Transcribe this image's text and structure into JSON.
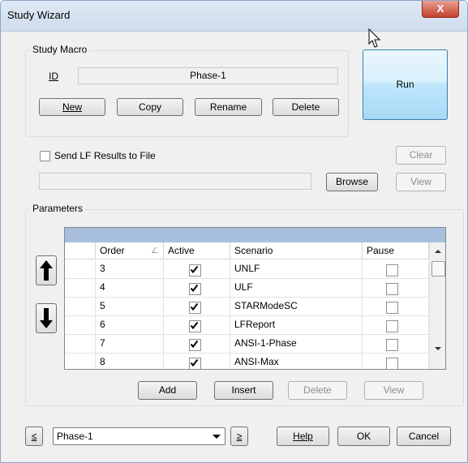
{
  "window": {
    "title": "Study Wizard",
    "close_glyph": "X"
  },
  "study_macro": {
    "label": "Study Macro",
    "id_label": "ID",
    "id_value": "Phase-1",
    "buttons": {
      "new": "New",
      "copy": "Copy",
      "rename": "Rename",
      "delete": "Delete"
    }
  },
  "run_label": "Run",
  "send_results": {
    "label": "Send LF Results to File",
    "checked": false,
    "path_value": ""
  },
  "clear_label": "Clear",
  "browse_label": "Browse",
  "view_label": "View",
  "parameters": {
    "label": "Parameters",
    "columns": {
      "order": "Order",
      "active": "Active",
      "scenario": "Scenario",
      "pause": "Pause"
    },
    "sort_glyph": "∠",
    "rows": [
      {
        "order": "3",
        "active": true,
        "scenario": "UNLF",
        "pause": false
      },
      {
        "order": "4",
        "active": true,
        "scenario": "ULF",
        "pause": false
      },
      {
        "order": "5",
        "active": true,
        "scenario": "STARModeSC",
        "pause": false
      },
      {
        "order": "6",
        "active": true,
        "scenario": "LFReport",
        "pause": false
      },
      {
        "order": "7",
        "active": true,
        "scenario": "ANSI-1-Phase",
        "pause": false
      },
      {
        "order": "8",
        "active": true,
        "scenario": "ANSI-Max",
        "pause": false
      }
    ],
    "buttons": {
      "add": "Add",
      "insert": "Insert",
      "delete": "Delete",
      "view": "View"
    }
  },
  "footer": {
    "prev_glyph": "≤",
    "combo_value": "Phase-1",
    "next_glyph": "≥",
    "help": "Help",
    "ok": "OK",
    "cancel": "Cancel"
  }
}
